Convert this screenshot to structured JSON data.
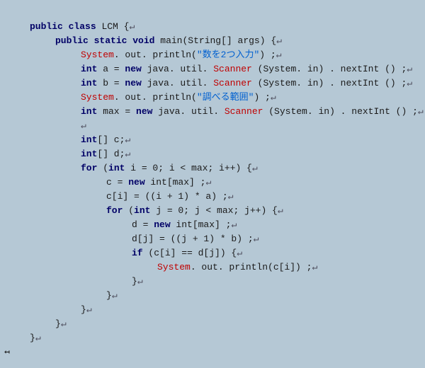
{
  "code": {
    "l1_kw1": "public",
    "l1_kw2": "class",
    "l1_cls": "LCM",
    "l1_brace": "{",
    "arrow": "↵",
    "l2_kw1": "public",
    "l2_kw2": "static",
    "l2_kw3": "void",
    "l2_m": "main",
    "l2_sig": "(String[] args) {",
    "l3_sys": "System",
    "l3_out": ". out. println(",
    "l3_str": "\"数を2つ入力\"",
    "l3_end": ") ;",
    "l4_type": "int",
    "l4_a": " a = ",
    "l4_new": "new",
    "l4_mid": " java. util. ",
    "l4_scn": "Scanner",
    "l4_tail": " (System. in) . nextInt () ;",
    "l5_type": "int",
    "l5_b": " b = ",
    "l5_new": "new",
    "l5_mid": " java. util. ",
    "l5_scn": "Scanner",
    "l5_tail": " (System. in) . nextInt () ;",
    "l6_sys": "System",
    "l6_out": ". out. println(",
    "l6_str": "\"調べる範囲\"",
    "l6_end": ") ;",
    "l7_type": "int",
    "l7_mx": " max = ",
    "l7_new": "new",
    "l7_mid": " java. util. ",
    "l7_scn": "Scanner",
    "l7_tail": " (System. in) . nextInt () ;",
    "l8": "",
    "l9_type": "int",
    "l9_rest": "[] c;",
    "l10_type": "int",
    "l10_rest": "[] d;",
    "l11_for": "for",
    "l11_open": " (",
    "l11_int": "int",
    "l11_rest": " i = 0; i < max; i++) {",
    "l12_c": "c = ",
    "l12_new": "new",
    "l12_rest": " int[max] ;",
    "l13": "c[i] = ((i + 1) * a) ;",
    "l14_for": "for",
    "l14_open": " (",
    "l14_int": "int",
    "l14_rest": " j = 0; j < max; j++) {",
    "l15_d": "d = ",
    "l15_new": "new",
    "l15_rest": " int[max] ;",
    "l16": "d[j] = ((j + 1) * b) ;",
    "l17_if": "if",
    "l17_rest": " (c[i] == d[j]) {",
    "l18_sys": "System",
    "l18_rest": ". out. println(c[i]) ;",
    "l19": "}",
    "l20": "}",
    "l21": "}",
    "l22": "}",
    "l23": "}",
    "cursor": "↤"
  }
}
